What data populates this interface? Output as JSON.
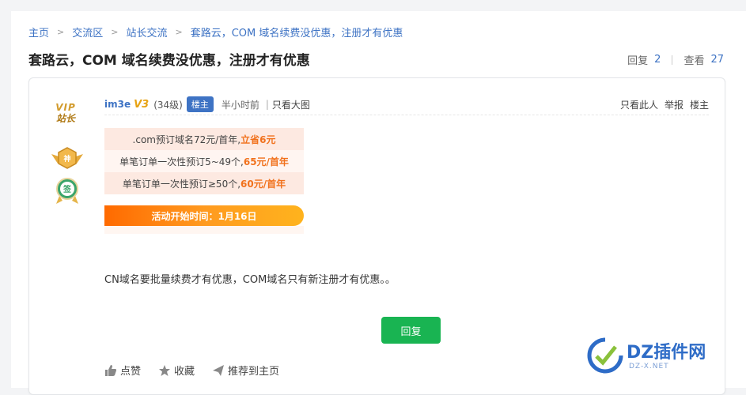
{
  "breadcrumb": [
    "主页",
    "交流区",
    "站长交流",
    "套路云，COM 域名续费没优惠，注册才有优惠"
  ],
  "title": "套路云，COM 域名续费没优惠，注册才有优惠",
  "stats": {
    "reply_label": "回复",
    "reply_count": "2",
    "view_label": "查看",
    "view_count": "27"
  },
  "user": {
    "vip_line1": "VIP",
    "vip_line2": "站长",
    "name": "im3e",
    "vbadge": "V3",
    "level": "(34级)",
    "owner_tag": "楼主",
    "time": "半小时前",
    "bar": "|",
    "view_big": "只看大图"
  },
  "header_links": [
    "只看此人",
    "举报",
    "楼主"
  ],
  "promo": {
    "row1_a": ".com预订域名72元/首年,",
    "row1_b": "立省6元",
    "row2_a": "单笔订单一次性预订5~49个,",
    "row2_b": "65元/首年",
    "row3_a": "单笔订单一次性预订≥50个,",
    "row3_b": "60元/首年",
    "button": "活动开始时间：1月16日"
  },
  "content": "CN域名要批量续费才有优惠，COM域名只有新注册才有优惠。。",
  "reply_button": "回复",
  "actions": {
    "like": "点赞",
    "favorite": "收藏",
    "recommend": "推荐到主页"
  },
  "watermark": {
    "text": "DZ插件网",
    "sub": "DZ-X.NET"
  },
  "colors": {
    "link": "#3e73c4",
    "reply": "#19b452",
    "accent": "#f1711c"
  }
}
